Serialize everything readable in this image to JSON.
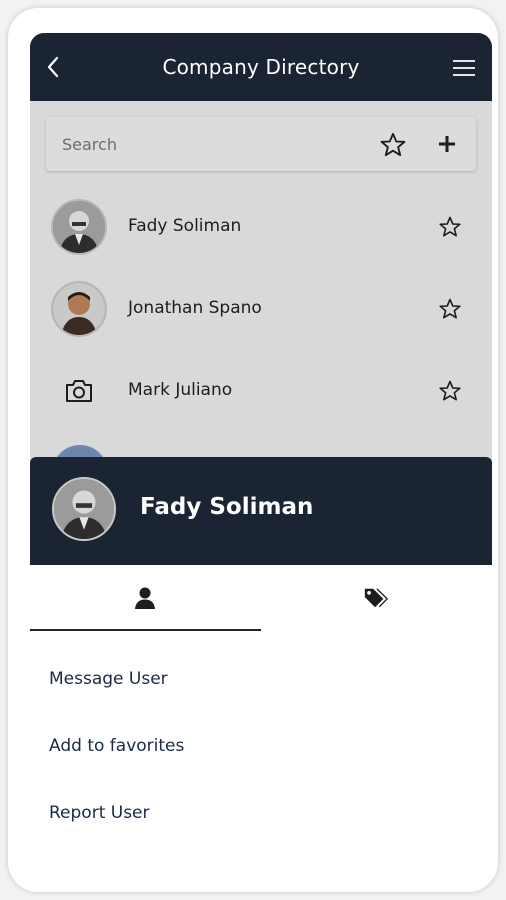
{
  "header": {
    "title": "Company Directory",
    "back_icon": "chevron-left-icon",
    "menu_icon": "hamburger-menu-icon"
  },
  "search": {
    "placeholder": "Search",
    "favorites_icon": "star-outline-icon",
    "add_icon": "plus-icon"
  },
  "contacts": [
    {
      "name": "Fady Soliman",
      "avatar": "photo",
      "star_icon": "star-outline-icon"
    },
    {
      "name": "Jonathan Spano",
      "avatar": "photo",
      "star_icon": "star-outline-icon"
    },
    {
      "name": "Mark Juliano",
      "avatar": "camera-icon",
      "star_icon": "star-outline-icon"
    }
  ],
  "sheet": {
    "name": "Fady Soliman",
    "tabs": [
      {
        "icon": "person-icon",
        "selected": true
      },
      {
        "icon": "tags-icon",
        "selected": false
      }
    ],
    "actions": [
      "Message User",
      "Add to favorites",
      "Report User"
    ]
  },
  "colors": {
    "header_bg": "#1b2432",
    "list_bg": "#d9d9d9",
    "action_text": "#1b2a48"
  }
}
